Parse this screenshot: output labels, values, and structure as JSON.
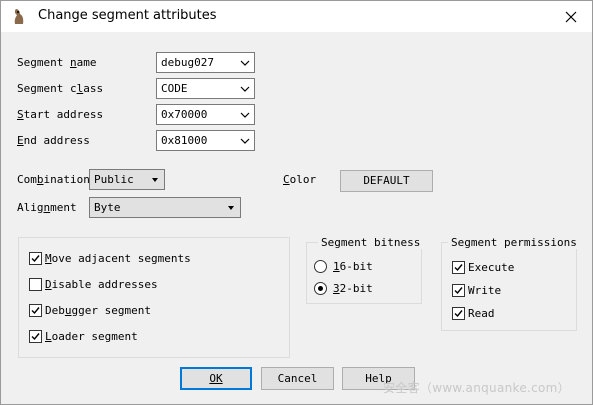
{
  "window": {
    "title": "Change segment attributes"
  },
  "fields": {
    "segment_name": {
      "label": "Segment name",
      "value": "debug027"
    },
    "segment_class": {
      "label": "Segment class",
      "value": "CODE"
    },
    "start_address": {
      "label": "Start address",
      "value": "0x70000"
    },
    "end_address": {
      "label": "End address",
      "value": "0x81000"
    },
    "combination": {
      "label": "Combination",
      "value": "Public"
    },
    "alignment": {
      "label": "Alignment",
      "value": "Byte"
    },
    "color": {
      "label": "Color",
      "button": "DEFAULT"
    }
  },
  "options": [
    {
      "label": "Move adjacent segments",
      "checked": true
    },
    {
      "label": "Disable addresses",
      "checked": false
    },
    {
      "label": "Debugger segment",
      "checked": true
    },
    {
      "label": "Loader segment",
      "checked": true
    }
  ],
  "bitness": {
    "title": "Segment bitness",
    "options": [
      {
        "label": "16-bit",
        "selected": false
      },
      {
        "label": "32-bit",
        "selected": true
      }
    ]
  },
  "permissions": {
    "title": "Segment permissions",
    "items": [
      {
        "label": "Execute",
        "checked": true
      },
      {
        "label": "Write",
        "checked": true
      },
      {
        "label": "Read",
        "checked": true
      }
    ]
  },
  "buttons": {
    "ok": "OK",
    "cancel": "Cancel",
    "help": "Help"
  },
  "watermark": "安全客（www.anquanke.com）"
}
